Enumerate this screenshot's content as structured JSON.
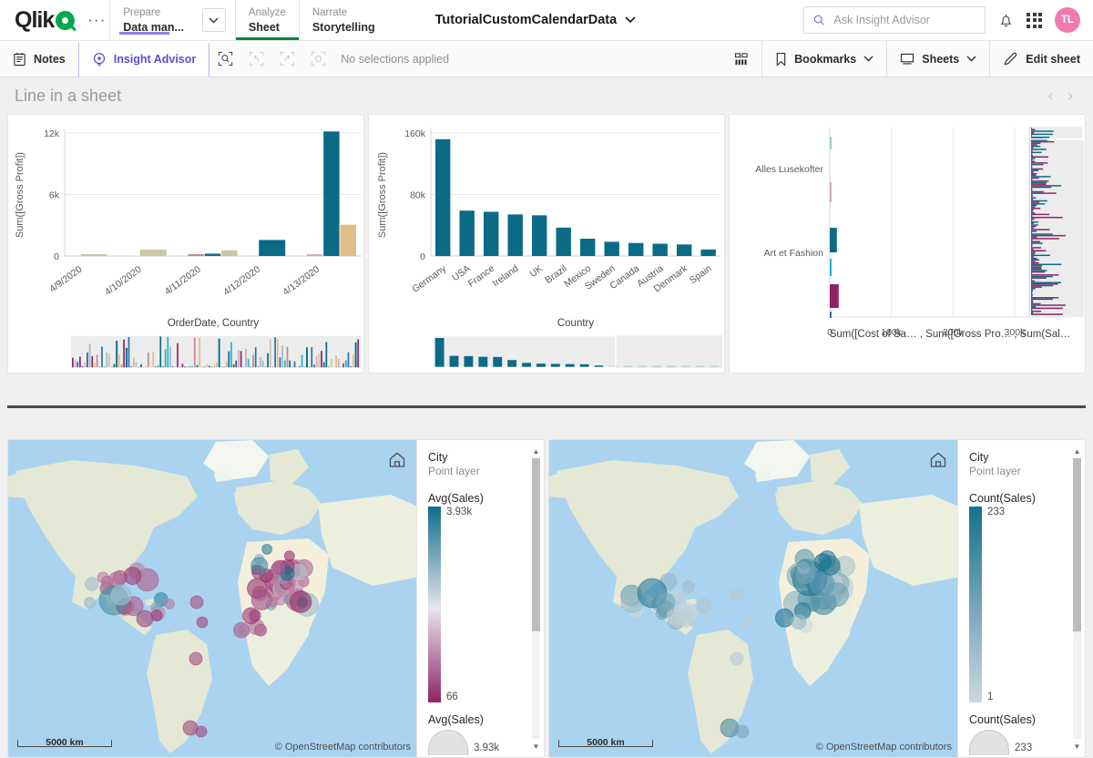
{
  "topbar": {
    "logo_text": "Qlik",
    "overflow_label": "···",
    "nav": [
      {
        "top": "Prepare",
        "bottom": "Data man...",
        "state": "purple"
      },
      {
        "top": "Analyze",
        "bottom": "Sheet",
        "state": "active"
      },
      {
        "top": "Narrate",
        "bottom": "Storytelling",
        "state": "none"
      }
    ],
    "app_title": "TutorialCustomCalendarData",
    "search_placeholder": "Ask Insight Advisor",
    "search_value": "",
    "avatar_initials": "TL"
  },
  "toolbar": {
    "notes_label": "Notes",
    "insight_advisor_label": "Insight Advisor",
    "selection_status": "No selections applied",
    "bookmarks_label": "Bookmarks",
    "sheets_label": "Sheets",
    "edit_sheet_label": "Edit sheet"
  },
  "sheet": {
    "title": "Line in a sheet",
    "prev_label": "‹",
    "next_label": "›"
  },
  "chart_data": [
    {
      "type": "bar",
      "title": "",
      "xlabel": "OrderDate, Country",
      "ylabel": "Sum([Gross Profit])",
      "categories": [
        "4/9/2020",
        "4/10/2020",
        "4/11/2020",
        "4/12/2020",
        "4/13/2020"
      ],
      "ylim": [
        0,
        12000
      ],
      "yticks": [
        0,
        6000,
        12000
      ],
      "ytick_labels": [
        "0",
        "6k",
        "12k"
      ],
      "grid": true,
      "legend": "none",
      "bars": [
        {
          "group": "4/9/2020",
          "value": 120,
          "color": "#ccc6a4"
        },
        {
          "group": "4/10/2020",
          "value": 620,
          "color": "#ccc6a4"
        },
        {
          "group": "4/11/2020",
          "value": 160,
          "color": "#c2888d"
        },
        {
          "group": "4/11/2020",
          "value": 230,
          "color": "#1a6b8a"
        },
        {
          "group": "4/11/2020",
          "value": 560,
          "color": "#ccc6a4"
        },
        {
          "group": "4/12/2020",
          "value": 1560,
          "color": "#0b6b87"
        },
        {
          "group": "4/13/2020",
          "value": 130,
          "color": "#d4b0b3"
        },
        {
          "group": "4/13/2020",
          "value": 12150,
          "color": "#0b6b87"
        },
        {
          "group": "4/13/2020",
          "value": 3060,
          "color": "#e0bd86"
        }
      ],
      "scrollbar": {
        "visible": true,
        "window_start": 0.0,
        "window_end": 1.0
      }
    },
    {
      "type": "bar",
      "title": "",
      "xlabel": "Country",
      "ylabel": "Sum([Gross Profit])",
      "categories": [
        "Germany",
        "USA",
        "France",
        "Ireland",
        "UK",
        "Brazil",
        "Mexico",
        "Sweden",
        "Canada",
        "Austria",
        "Denmark",
        "Spain"
      ],
      "values": [
        152000,
        59000,
        57500,
        54000,
        53000,
        37000,
        22500,
        18500,
        17000,
        16000,
        15000,
        8500
      ],
      "color": "#0b6b87",
      "ylim": [
        0,
        160000
      ],
      "yticks": [
        0,
        80000,
        160000
      ],
      "ytick_labels": [
        "0",
        "80k",
        "160k"
      ],
      "grid": true,
      "scrollbar": {
        "visible": true,
        "window_start": 0.0,
        "window_end": 0.63,
        "overview_values": [
          152000,
          59000,
          57500,
          54000,
          53000,
          37000,
          22500,
          18500,
          17000,
          16000,
          15000,
          8500,
          3000,
          2500,
          2200,
          2000,
          1800,
          1500,
          1200,
          900
        ]
      }
    },
    {
      "type": "bar",
      "orientation": "horizontal",
      "title": "",
      "xlabel": "Sum([Cost of Sa… , Sum([Gross Pro… , Sum(Sal…",
      "ylabel": "",
      "ytick_labels": [
        "Alles Lusekofter",
        "Art et Fashion"
      ],
      "xticks": [
        0,
        100000,
        200000,
        300000
      ],
      "xtick_labels": [
        "0",
        "100k",
        "200k",
        "300k"
      ],
      "xlim": [
        0,
        340000
      ],
      "grid": true,
      "bars": [
        {
          "value": 1200,
          "color": "#9ecad6"
        },
        {
          "value": 900,
          "color": "#d8aeb6"
        },
        {
          "value": 11500,
          "color": "#0b6b87"
        },
        {
          "value": 2400,
          "color": "#1fb5c4"
        },
        {
          "value": 14500,
          "color": "#8e2463"
        },
        {
          "value": 1500,
          "color": "#2f6fa8"
        }
      ],
      "scrollbar": {
        "visible": true,
        "window_start": 0.0,
        "window_end": 0.07
      }
    }
  ],
  "maps": [
    {
      "layer_title": "City",
      "layer_subtitle": "Point layer",
      "color_measure": "Avg(Sales)",
      "color_max_label": "3.93k",
      "color_min_label": "66",
      "gradient_top": "#0e6e8c",
      "gradient_mid": "#e8e4ea",
      "gradient_bottom": "#8e2463",
      "size_measure": "Avg(Sales)",
      "size_max_label": "3.93k",
      "scale_label": "5000 km",
      "attribution": "© OpenStreetMap contributors",
      "home_icon": "home-icon"
    },
    {
      "layer_title": "City",
      "layer_subtitle": "Point layer",
      "color_measure": "Count(Sales)",
      "color_max_label": "233",
      "color_min_label": "1",
      "gradient_top": "#16708e",
      "gradient_mid": "#7ea9bb",
      "gradient_bottom": "#cdd7dd",
      "size_measure": "Count(Sales)",
      "size_max_label": "233",
      "scale_label": "5000 km",
      "attribution": "© OpenStreetMap contributors",
      "home_icon": "home-icon"
    }
  ],
  "colors": {
    "brand_green": "#00a94f",
    "accent_purple": "#5a4fcf",
    "teal": "#0b6b87",
    "magenta": "#8e2463"
  }
}
